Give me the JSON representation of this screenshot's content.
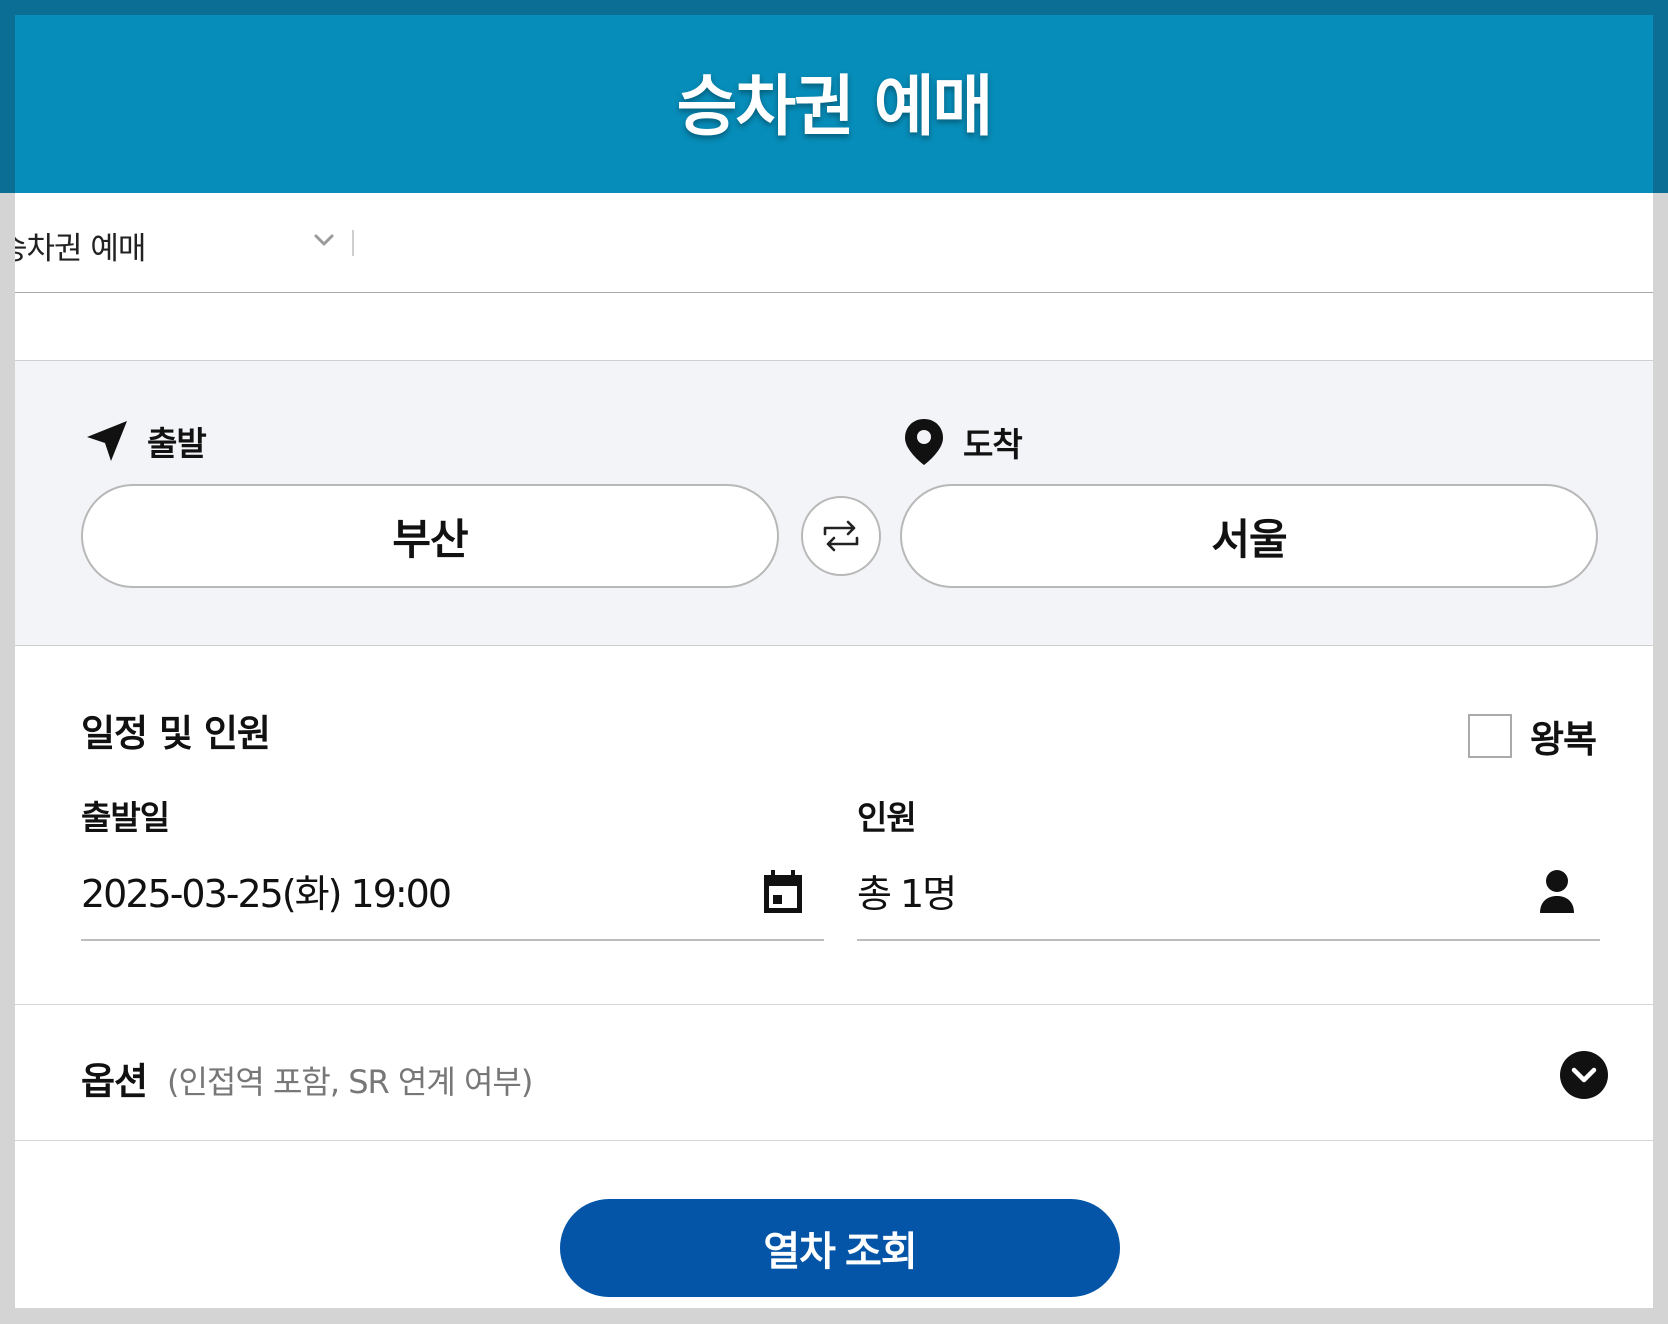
{
  "header": {
    "title": "승차권 예매"
  },
  "breadcrumb": {
    "label": "승차권 예매",
    "icon": "chevron-down-icon"
  },
  "route": {
    "departure_label": "출발",
    "departure_icon": "navigation-arrow-icon",
    "departure_station": "부산",
    "arrival_label": "도착",
    "arrival_icon": "map-pin-icon",
    "arrival_station": "서울",
    "swap_icon": "swap-icon"
  },
  "schedule": {
    "title": "일정 및 인원",
    "roundtrip_label": "왕복",
    "roundtrip_checked": false,
    "date_label": "출발일",
    "date_value": "2025-03-25(화) 19:00",
    "date_icon": "calendar-icon",
    "passenger_label": "인원",
    "passenger_value": "총 1명",
    "passenger_icon": "person-icon"
  },
  "options": {
    "title": "옵션",
    "subtitle": "(인접역 포함, SR 연계 여부)",
    "toggle_icon": "chevron-down-circle-icon"
  },
  "search_button": {
    "label": "열차 조회"
  },
  "colors": {
    "header_bg": "#078db9",
    "header_edge": "#0b6f95",
    "primary_button": "#0455a7",
    "route_bg": "#f3f4f7"
  }
}
